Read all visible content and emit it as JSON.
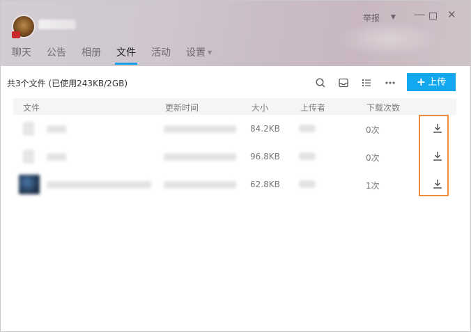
{
  "header": {
    "report_label": "举报",
    "tabs": [
      {
        "label": "聊天",
        "active": false
      },
      {
        "label": "公告",
        "active": false
      },
      {
        "label": "相册",
        "active": false
      },
      {
        "label": "文件",
        "active": true
      },
      {
        "label": "活动",
        "active": false
      },
      {
        "label": "设置",
        "active": false,
        "has_dropdown": true
      }
    ]
  },
  "toolbar": {
    "summary": "共3个文件 (已使用243KB/2GB)",
    "upload_label": "上传",
    "icons": [
      "search-icon",
      "inbox-icon",
      "list-view-icon",
      "more-icon"
    ]
  },
  "table": {
    "columns": [
      "文件",
      "更新时间",
      "大小",
      "上传者",
      "下载次数"
    ],
    "rows": [
      {
        "size": "84.2KB",
        "downloads": "0次"
      },
      {
        "size": "96.8KB",
        "downloads": "0次"
      },
      {
        "size": "62.8KB",
        "downloads": "1次"
      }
    ]
  },
  "colors": {
    "accent": "#12a7ef",
    "tab_underline": "#1a9ee6",
    "highlight": "#ef8a3c"
  }
}
